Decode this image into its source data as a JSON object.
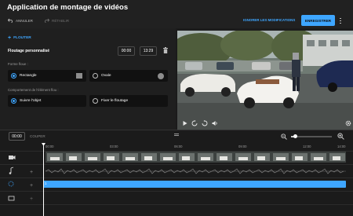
{
  "header": {
    "title": "Application de montage de vidéos",
    "undo_label": "ANNULER",
    "redo_label": "RÉTABLIR",
    "ignore_label": "IGNORER LES MODIFICATIONS",
    "save_label": "ENREGISTRER"
  },
  "blur_panel": {
    "add_label": "FLOUTER",
    "custom_blur_label": "Floutage personnalisé",
    "start_time": "00:00",
    "end_time": "13:29",
    "shape_label": "Forme floue :",
    "shape_options": [
      {
        "label": "Rectangle",
        "selected": true
      },
      {
        "label": "Ovale",
        "selected": false
      }
    ],
    "behavior_label": "Comportement de l'élément flou :",
    "behavior_options": [
      {
        "label": "Suivre l'objet",
        "selected": true
      },
      {
        "label": "Fixer le floutage",
        "selected": false
      }
    ]
  },
  "timeline": {
    "current_time": "00:00",
    "cut_label": "COUPER",
    "ticks": [
      "00:00",
      "03:00",
      "06:00",
      "09:00",
      "12:00",
      "14:00"
    ],
    "zoom_level": 0.1,
    "blur_track_label": "1"
  },
  "colors": {
    "accent": "#3ea6ff",
    "background": "#1b1b1b",
    "panel": "#1f1f1f"
  },
  "icons": [
    "undo-icon",
    "redo-icon",
    "plus-icon",
    "trash-icon",
    "kebab-icon",
    "play-icon",
    "rewind-icon",
    "forward-icon",
    "volume-icon",
    "settings-icon",
    "zoom-out-icon",
    "zoom-in-icon",
    "video-track-icon",
    "audio-track-icon",
    "blur-track-icon",
    "text-track-icon"
  ]
}
